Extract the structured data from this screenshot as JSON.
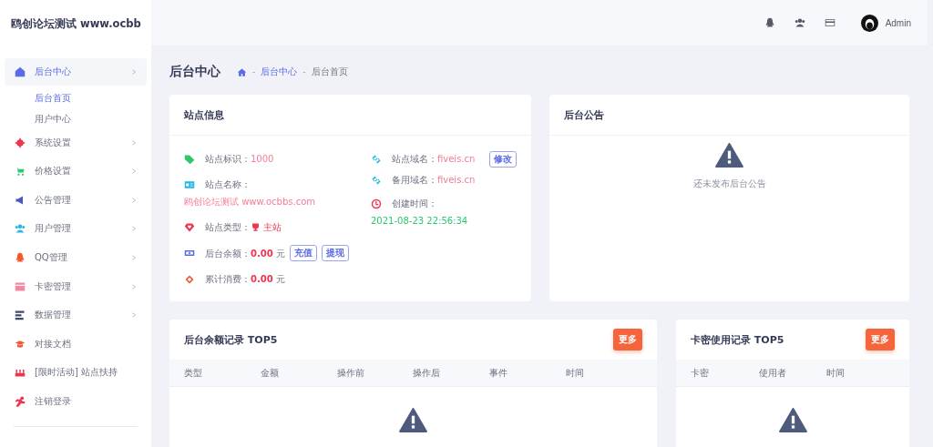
{
  "brand": "鸥创论坛测试 www.ocbb",
  "header": {
    "icons": [
      {
        "kind": "qq"
      },
      {
        "kind": "users"
      },
      {
        "kind": "card"
      }
    ],
    "user": "Admin"
  },
  "sidebar": {
    "items": [
      {
        "label": "后台中心",
        "kind": "home",
        "color": "#5b6be6",
        "submenu": true,
        "selected": true,
        "children": [
          {
            "label": "后台首页",
            "selected": true
          },
          {
            "label": "用户中心",
            "selected": false
          }
        ]
      },
      {
        "label": "系统设置",
        "kind": "gear",
        "color": "#f0344f",
        "submenu": true,
        "selected": false
      },
      {
        "label": "价格设置",
        "kind": "cart",
        "color": "#2ec770",
        "submenu": true,
        "selected": false
      },
      {
        "label": "公告管理",
        "kind": "megaphone",
        "color": "#4a56c9",
        "submenu": true,
        "selected": false
      },
      {
        "label": "用户管理",
        "kind": "users",
        "color": "#22b8e6",
        "submenu": true,
        "selected": false
      },
      {
        "label": "QQ管理",
        "kind": "qq",
        "color": "#f6552d",
        "submenu": true,
        "selected": false
      },
      {
        "label": "卡密管理",
        "kind": "card",
        "color": "#f08aa0",
        "submenu": true,
        "selected": false
      },
      {
        "label": "数据管理",
        "kind": "list",
        "color": "#3f4a6b",
        "submenu": true,
        "selected": false
      },
      {
        "label": "对接文档",
        "kind": "cap",
        "color": "#f6552d",
        "submenu": false,
        "selected": false
      },
      {
        "label": "[限时活动] 站点扶持",
        "kind": "cake",
        "color": "#f0344f",
        "submenu": false,
        "selected": false
      },
      {
        "label": "注销登录",
        "kind": "run",
        "color": "#f0344f",
        "submenu": false,
        "selected": false
      }
    ]
  },
  "page": {
    "title": "后台中心",
    "separator": "-",
    "breadcrumb": [
      "后台中心",
      "后台首页"
    ]
  },
  "site_info": {
    "title": "站点信息",
    "left": [
      {
        "kind": "tag",
        "icon": {
          "color": "#2ec770"
        },
        "label": "站点标识：",
        "value": "1000",
        "color": "#f57c95",
        "strong": false
      },
      {
        "kind": "idcard",
        "icon": {
          "color": "#22b8e6"
        },
        "label": "站点名称：",
        "value": "鸥创论坛测试 www.ocbbs.com",
        "color": "#f57c95",
        "strong": false
      },
      {
        "kind": "diamond",
        "icon": {
          "color": "#f0344f"
        },
        "label": "站点类型：",
        "value": "主站",
        "value_icon": {
          "kind": "trophy"
        },
        "color": "#f0344f",
        "strong": false
      },
      {
        "kind": "money",
        "icon": {
          "color": "#5b6be6"
        },
        "label": "后台余额：",
        "value": "0.00",
        "unit": "元",
        "color": "#f0344f",
        "strong": true,
        "buttons": [
          "充值",
          "提现"
        ]
      },
      {
        "kind": "ticket",
        "icon": {
          "color": "#f6552d"
        },
        "label": "累计消费：",
        "value": "0.00",
        "unit": "元",
        "color": "#f0344f",
        "strong": true
      }
    ],
    "right": [
      {
        "kind": "link",
        "icon": {
          "color": "#22b8e6"
        },
        "label": "站点域名：",
        "value": "fiveis.cn",
        "color": "#f57c95",
        "strong": false,
        "buttons": [
          "修改"
        ]
      },
      {
        "kind": "link",
        "icon": {
          "color": "#22b8e6"
        },
        "label": "备用域名：",
        "value": "fiveis.cn",
        "color": "#f57c95",
        "strong": false
      },
      {
        "kind": "clock",
        "icon": {
          "color": "#f0344f"
        },
        "label": "创建时间：",
        "value": "2021-08-23 22:56:34",
        "color": "#2ec770",
        "strong": false
      }
    ]
  },
  "notice": {
    "title": "后台公告",
    "empty": "还未发布后台公告"
  },
  "records": [
    {
      "title": "后台余额记录 TOP5",
      "more": "更多",
      "columns": [
        "类型",
        "金额",
        "操作前",
        "操作后",
        "事件",
        "时间"
      ]
    },
    {
      "title": "卡密使用记录 TOP5",
      "more": "更多",
      "columns": [
        "卡密",
        "使用者",
        "时间"
      ]
    }
  ]
}
